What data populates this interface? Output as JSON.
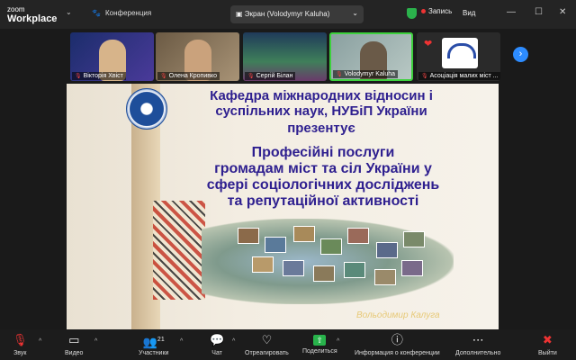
{
  "app": {
    "brand_line1": "zoom",
    "brand_line2": "Workplace"
  },
  "titlebar": {
    "conference": "Конференция",
    "screen_tab": "Экран (Volodymyr Kaluha)",
    "recording": "Запись",
    "view": "Вид"
  },
  "gallery": {
    "participants": [
      {
        "name": "Вікторія Хвіст"
      },
      {
        "name": "Олена Кропивко"
      },
      {
        "name": "Сергій Білан"
      },
      {
        "name": "Volodymyr Kaluha"
      },
      {
        "name": "Асоціація малих міст ..."
      }
    ]
  },
  "slide": {
    "title_line1": "Кафедра міжнародних відносин і",
    "title_line2": "суспільних наук, НУБіП України",
    "title_line3": "презентує",
    "subtitle_line1": "Професійні послуги",
    "subtitle_line2": "громадам міст та сіл України  у",
    "subtitle_line3": "сфері соціологічних досліджень",
    "subtitle_line4": "та репутаційної активності",
    "signature": "Вольодимир Калуга"
  },
  "toolbar": {
    "audio": "Звук",
    "video": "Видео",
    "participants": "Участники",
    "participants_count": "21",
    "chat": "Чат",
    "react": "Отреагировать",
    "share": "Поделиться",
    "info": "Информация о конференции",
    "more": "Дополнительно",
    "leave": "Выйти"
  },
  "colors": {
    "accent": "#2d8cff",
    "share_green": "#28b34b",
    "active_speaker": "#3dd13d",
    "record": "#e33333"
  }
}
